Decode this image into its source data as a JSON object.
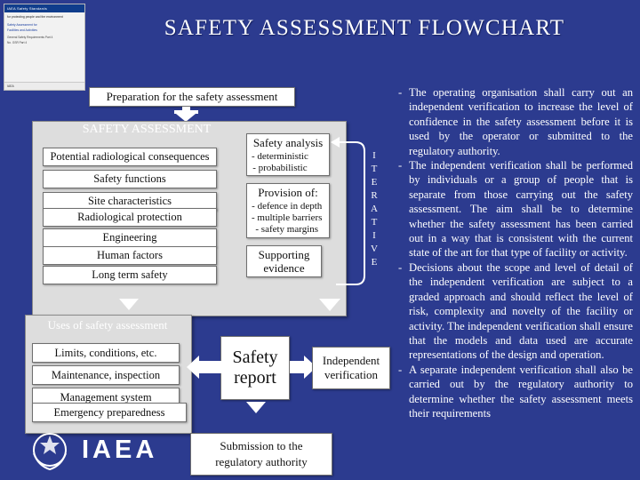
{
  "slide": {
    "title": "SAFETY ASSESSMENT FLOWCHART",
    "logo": {
      "header": "IAEA Safety Standards",
      "line1": "for protecting people and the environment",
      "line2": "Safety Assessment for",
      "line3": "Facilities and Activities",
      "sub": "General Safety Requirements Part 4",
      "code": "No. GSR Part 4",
      "foot": "IAEA"
    },
    "boxes": {
      "preparation": "Preparation for the safety assessment",
      "safety_assessment_heading": "SAFETY ASSESSMENT",
      "potential_radiological": "Potential radiological consequences",
      "safety_functions": "Safety functions",
      "site_characteristics": "Site characteristics",
      "radiological_protection": "Radiological protection",
      "engineering": "Engineering",
      "human_factors": "Human factors",
      "long_term_safety": "Long term safety",
      "safety_analysis_title": "Safety analysis",
      "safety_analysis_items": "- deterministic\n- probabilistic",
      "provision_title": "Provision of:",
      "provision_items": "- defence in depth\n- multiple barriers\n- safety margins",
      "supporting_evidence": "Supporting\nevidence",
      "iterative": "ITERATIVE",
      "uses_heading": "Uses of safety assessment",
      "limits": "Limits, conditions, etc.",
      "maintenance": "Maintenance, inspection",
      "management": "Management system",
      "emergency": "Emergency preparedness",
      "safety_report": "Safety\nreport",
      "independent_verification": "Independent\nverification",
      "submission": "Submission to the\nregulatory authority"
    },
    "right_text": [
      "The operating organisation shall carry out an independent verification to increase the level of confidence in the safety assessment before it is used by the operator or submitted to the regulatory authority.",
      "The independent verification shall be performed by individuals or a group of people that is separate from those carrying out the safety assessment. The aim shall be to determine whether the safety assessment has been carried out in a way that is consistent with the current state of the art for that type of facility or activity.",
      "Decisions about the scope and level of detail of the independent verification are subject to a graded approach and should reflect the level of risk, complexity and novelty of the facility or activity. The independent verification shall ensure that the models and data used are accurate representations of the design and operation.",
      "A separate independent verification shall also be carried out by the regulatory authority to determine whether the safety assessment meets their requirements"
    ],
    "footer_logo": "IAEA",
    "colors": {
      "background": "#2c3b8f",
      "panel": "#dddddd",
      "box": "#ffffff",
      "text_light": "#ffffff"
    }
  }
}
